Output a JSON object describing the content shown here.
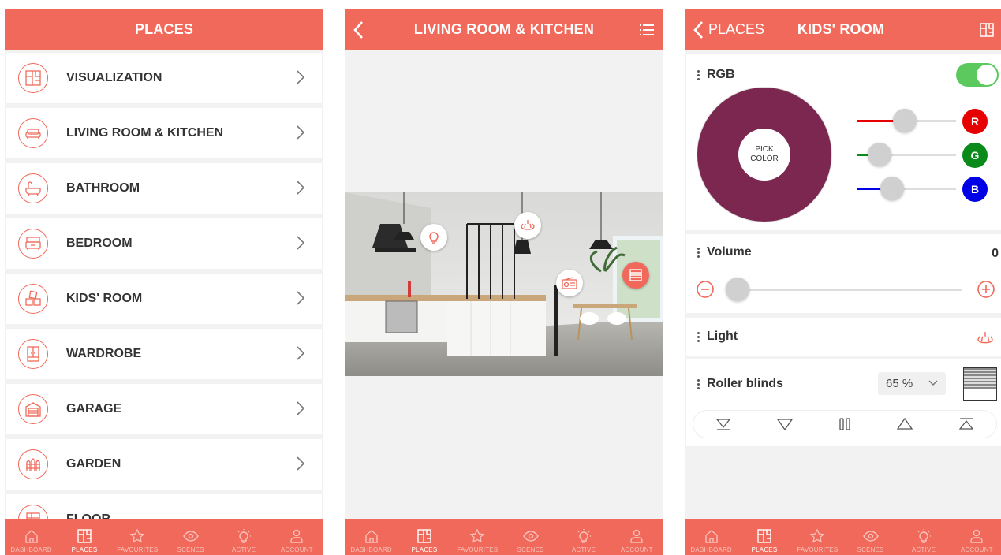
{
  "tabbar": [
    {
      "label": "DASHBOARD",
      "icon": "home-icon"
    },
    {
      "label": "PLACES",
      "icon": "floorplan-icon"
    },
    {
      "label": "FAVOURITES",
      "icon": "star-icon"
    },
    {
      "label": "SCENES",
      "icon": "eye-icon"
    },
    {
      "label": "ACTIVE",
      "icon": "bulb-icon"
    },
    {
      "label": "ACCOUNT",
      "icon": "user-icon"
    }
  ],
  "screen1": {
    "title": "PLACES",
    "items": [
      {
        "label": "VISUALIZATION",
        "icon": "floorplan-icon"
      },
      {
        "label": "LIVING ROOM & KITCHEN",
        "icon": "sofa-icon"
      },
      {
        "label": "BATHROOM",
        "icon": "bathtub-icon"
      },
      {
        "label": "BEDROOM",
        "icon": "bed-icon"
      },
      {
        "label": "KIDS' ROOM",
        "icon": "toy-blocks-icon"
      },
      {
        "label": "WARDROBE",
        "icon": "wardrobe-icon"
      },
      {
        "label": "GARAGE",
        "icon": "garage-icon"
      },
      {
        "label": "GARDEN",
        "icon": "fence-icon"
      },
      {
        "label": "FLOOR",
        "icon": "floor-icon"
      }
    ]
  },
  "screen2": {
    "title": "LIVING ROOM & KITCHEN",
    "hotspots": [
      "bulb-icon",
      "chandelier-icon",
      "radio-icon",
      "blinds-icon"
    ]
  },
  "screen3": {
    "back_label": "PLACES",
    "title": "KIDS' ROOM",
    "rgb": {
      "title": "RGB",
      "enabled": true,
      "pick_label_1": "PICK",
      "pick_label_2": "COLOR",
      "color": "#7b2750",
      "channels": [
        {
          "label": "R",
          "color": "#e60000",
          "value": 123
        },
        {
          "label": "G",
          "color": "#0a8a1a",
          "value": 39
        },
        {
          "label": "B",
          "color": "#0000e6",
          "value": 80
        }
      ]
    },
    "volume": {
      "title": "Volume",
      "value": "0"
    },
    "light": {
      "title": "Light"
    },
    "blinds": {
      "title": "Roller blinds",
      "value": "65 %"
    }
  },
  "colors": {
    "accent": "#f0695a",
    "toggle": "#5cc95e"
  }
}
